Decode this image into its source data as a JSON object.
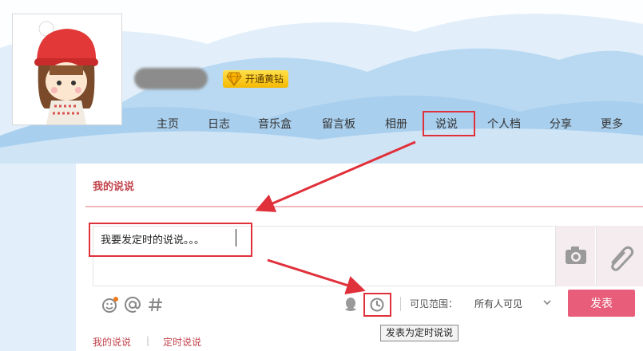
{
  "header": {
    "vip_label": "开通黄钻"
  },
  "nav": {
    "items": [
      {
        "label": "主页"
      },
      {
        "label": "日志"
      },
      {
        "label": "音乐盒"
      },
      {
        "label": "留言板"
      },
      {
        "label": "相册"
      },
      {
        "label": "说说",
        "highlighted": true
      },
      {
        "label": "个人档"
      },
      {
        "label": "分享"
      },
      {
        "label": "更多"
      }
    ]
  },
  "panel": {
    "tab_title": "我的说说",
    "composer_text": "我要发定时的说说。。。",
    "visibility_label": "可见范围：",
    "visibility_value": "所有人可见",
    "post_label": "发表",
    "timer_tooltip": "发表为定时说说"
  },
  "bottom_tabs": {
    "mine": "我的说说",
    "scheduled": "定时说说"
  },
  "icons": {
    "toolbar": [
      "emoji-icon",
      "at-icon",
      "hashtag-icon",
      "qq-icon",
      "timer-icon"
    ],
    "side": [
      "camera-icon",
      "attachment-icon"
    ]
  },
  "colors": {
    "accent": "#e85e7a",
    "annotation_red": "#e0303a",
    "tab_active": "#c2434c"
  }
}
